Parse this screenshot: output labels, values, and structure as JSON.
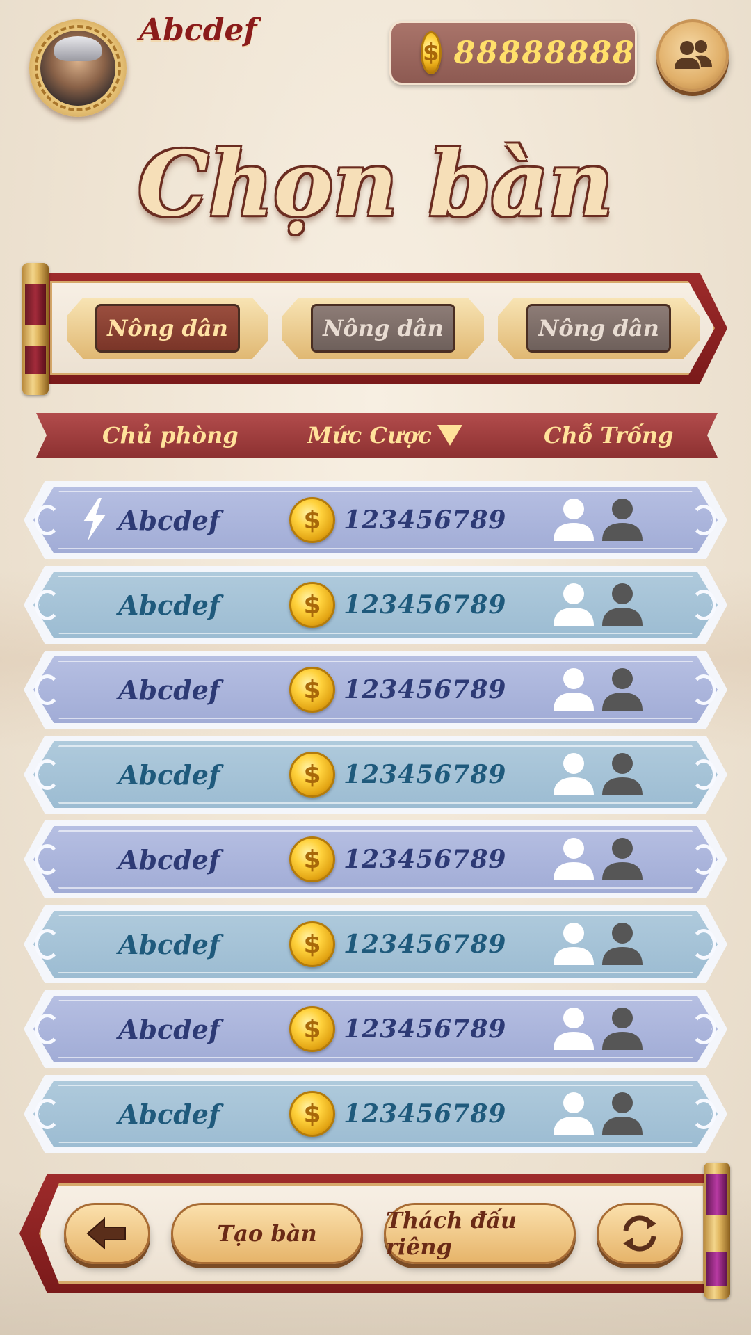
{
  "header": {
    "username": "Abcdef",
    "coins": "88888888",
    "coin_symbol": "$"
  },
  "title": "Chọn bàn",
  "tabs": [
    {
      "label": "Nông dân",
      "active": true
    },
    {
      "label": "Nông dân",
      "active": false
    },
    {
      "label": "Nông dân",
      "active": false
    }
  ],
  "columns": {
    "host": "Chủ phòng",
    "bet": "Mức Cược",
    "seats": "Chỗ Trống"
  },
  "rows": [
    {
      "host": "Abcdef",
      "bet": "123456789",
      "quick": true
    },
    {
      "host": "Abcdef",
      "bet": "123456789",
      "quick": false
    },
    {
      "host": "Abcdef",
      "bet": "123456789",
      "quick": false
    },
    {
      "host": "Abcdef",
      "bet": "123456789",
      "quick": false
    },
    {
      "host": "Abcdef",
      "bet": "123456789",
      "quick": false
    },
    {
      "host": "Abcdef",
      "bet": "123456789",
      "quick": false
    },
    {
      "host": "Abcdef",
      "bet": "123456789",
      "quick": false
    },
    {
      "host": "Abcdef",
      "bet": "123456789",
      "quick": false
    }
  ],
  "bottom": {
    "create_table": "Tạo bàn",
    "private_challenge": "Thách đấu riêng"
  },
  "colors": {
    "banner_red": "#9e2b2b",
    "row_blue": "#a1acd6",
    "row_teal": "#9cbcd2",
    "gold_text": "#ffe29a"
  },
  "icons": {
    "back": "back-arrow-icon",
    "refresh": "refresh-icon",
    "friends": "friends-icon",
    "quick": "lightning-icon",
    "seat_free": "person-white-icon",
    "seat_taken": "person-dark-icon"
  }
}
